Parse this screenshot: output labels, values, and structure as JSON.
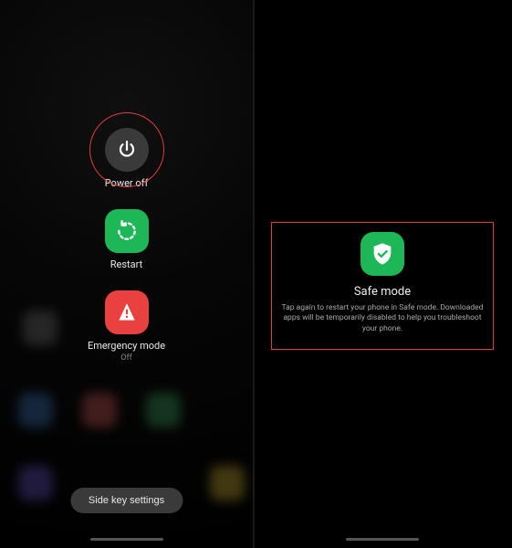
{
  "left_panel": {
    "power_off": {
      "label": "Power off"
    },
    "restart": {
      "label": "Restart"
    },
    "emergency": {
      "label": "Emergency mode",
      "sublabel": "Off"
    },
    "side_key_button": "Side key settings"
  },
  "right_panel": {
    "safe_mode": {
      "title": "Safe mode",
      "description": "Tap again to restart your phone in Safe mode. Downloaded apps will be temporarily disabled to help you troubleshoot your phone."
    }
  },
  "colors": {
    "highlight": "#e03e3e",
    "green": "#1eb757",
    "red": "#e8413f",
    "dark_btn": "#3a3a3a"
  }
}
